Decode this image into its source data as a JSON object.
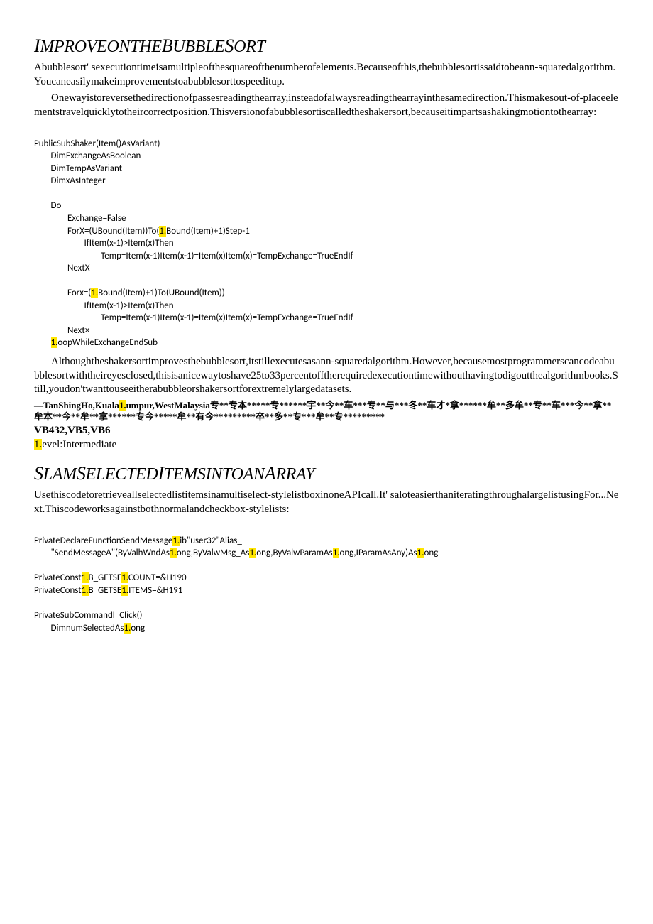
{
  "s1": {
    "title_parts": [
      "I",
      "MPROVEONTHE",
      "B",
      "UBBLE",
      "S",
      "ORT"
    ],
    "para1": "Abubblesort' sexecutiontimeisamultipleofthesquareofthenumberofelements.Becauseofthis,thebubblesortissaidtobeann-squaredalgorithm.Youcaneasilymakeimprovementstoabubblesorttospeeditup.",
    "para2": "Onewayistoreversethedirectionofpassesreadingthearray,insteadofalwaysreadingthearrayinthesamedirection.Thismakesout-of-placeelementstravelquicklytotheircorrectposition.Thisversionofabubblesortiscalledtheshakersort,becauseitimpartsashakingmotiontothearray:",
    "code_l1": "PublicSubShaker(Item()AsVariant)",
    "code_l2": "        DimExchangeAsBoolean",
    "code_l3": "        DimTempAsVariant",
    "code_l4": "        DimxAsInteger",
    "code_l5": "",
    "code_l6": "        Do",
    "code_l7a": "                Exchange=False",
    "code_l7b_pre": "                ForX=(UBound(Item))To(",
    "code_l7b_hl": "1.",
    "code_l7b_post": "Bound(Item)+1)Step-1",
    "code_l8": "                        IfItem(x-1)>Item(x)Then",
    "code_l9": "                                Temp=Item(x-1)Item(x-1)=Item(x)Item(x)=TempExchange=TrueEndIf",
    "code_l10": "                NextX",
    "code_l11": "",
    "code_l12_pre": "                Forx=(",
    "code_l12_hl": "1.",
    "code_l12_post": "Bound(Item)+1)To(UBound(Item))",
    "code_l13": "                        IfItem(x-1)>Item(x)Then",
    "code_l14": "                                Temp=Item(x-1)Item(x-1)=Item(x)Item(x)=TempExchange=TrueEndIf",
    "code_l15": "                Next×",
    "code_l16_pre": "        ",
    "code_l16_hl": "1.",
    "code_l16_post": "oopWhileExchangeEndSub",
    "para3": "Althoughtheshakersortimprovesthebubblesort,itstillexecutesasann-squaredalgorithm.However,becausemostprogrammerscancodeabubblesortwiththeireyesclosed,thisisanicewaytoshave25to33percentofftherequiredexecutiontimewithouthavingtodigoutthealgorithmbooks.Still,youdon'twanttouseeitherabubbleorshakersortforextremelylargedatasets.",
    "attrib_pre": "—TanShingHo,Kuala",
    "attrib_hl": "1.",
    "attrib_post": "umpur,WestMalaysia专**专本*****专******宇**今**车***专**与***冬**车才*拿******牟**多牟**专**车***今**拿**牟本**今**牟**拿******专今*****牟**有今*********卒**多**专***牟**专*********",
    "vb": "VB432,VB5,VB6",
    "level_hl": "1.",
    "level_post": "evel:Intermediate"
  },
  "s2": {
    "title_parts": [
      "S",
      "LAM",
      "S",
      "ELECTED",
      "I",
      "TEMSINTOAN",
      "A",
      "RRAY"
    ],
    "para1": "Usethiscodetoretrieveallselectedlistitemsinamultiselect-stylelistboxinoneAPIcall.It' saloteasierthaniteratingthroughalargelistusingFor...Next.Thiscodeworksagainstbothnormalandcheckbox-stylelists:",
    "c1_pre": "PrivateDeclareFunctionSendMessage",
    "c1_hl1": "1.",
    "c1_mid": "ib\"user32\"Alias_",
    "c2_pre": "        \"SendMessageA\"(ByValhWndAs",
    "c2_hl1": "1.",
    "c2_mid1": "ong,ByValwMsg_As",
    "c2_hl2": "1.",
    "c2_mid2": "ong,ByValwParamAs",
    "c2_hl3": "1.",
    "c2_mid3": "ong,IParamAsAny)As",
    "c2_hl4": "1.",
    "c2_post": "ong",
    "c3_pre": "PrivateConst",
    "c3_hl1": "1.",
    "c3_mid": "B_GETSE",
    "c3_hl2": "1.",
    "c3_post": "COUNT=&H190",
    "c4_pre": "PrivateConst",
    "c4_hl1": "1.",
    "c4_mid": "B_GETSE",
    "c4_hl2": "1.",
    "c4_post": "ITEMS=&H191",
    "c5": "PrivateSubCommandl_Click()",
    "c6_pre": "        DimnumSelectedAs",
    "c6_hl": "1.",
    "c6_post": "ong"
  }
}
